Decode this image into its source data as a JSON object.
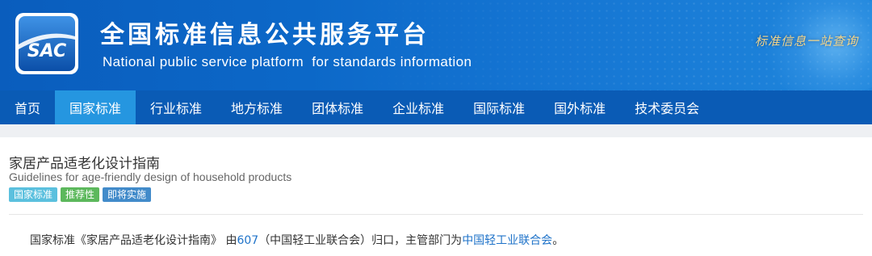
{
  "header": {
    "logo_text": "SAC",
    "title": "全国标准信息公共服务平台",
    "subtitle": "National public service platform  for standards information",
    "slogan": "标准信息一站查询",
    "colors": {
      "banner": "#0c68c8",
      "nav": "#0a5bb5",
      "nav_active": "#2596e0"
    }
  },
  "nav": {
    "items": [
      {
        "label": "首页",
        "active": false
      },
      {
        "label": "国家标准",
        "active": true
      },
      {
        "label": "行业标准",
        "active": false
      },
      {
        "label": "地方标准",
        "active": false
      },
      {
        "label": "团体标准",
        "active": false
      },
      {
        "label": "企业标准",
        "active": false
      },
      {
        "label": "国际标准",
        "active": false
      },
      {
        "label": "国外标准",
        "active": false
      },
      {
        "label": "技术委员会",
        "active": false
      }
    ]
  },
  "standard": {
    "title_cn": "家居产品适老化设计指南",
    "title_en": "Guidelines for age-friendly design of household products",
    "tags": [
      {
        "label": "国家标准",
        "color": "#5bc0de"
      },
      {
        "label": "推荐性",
        "color": "#5cb85c"
      },
      {
        "label": "即将实施",
        "color": "#428bca"
      }
    ],
    "description": {
      "prefix": "国家标准《家居产品适老化设计指南》 由",
      "committee_code": "607",
      "middle": "（中国轻工业联合会）归口，主管部门为",
      "department": "中国轻工业联合会",
      "suffix": "。"
    }
  }
}
